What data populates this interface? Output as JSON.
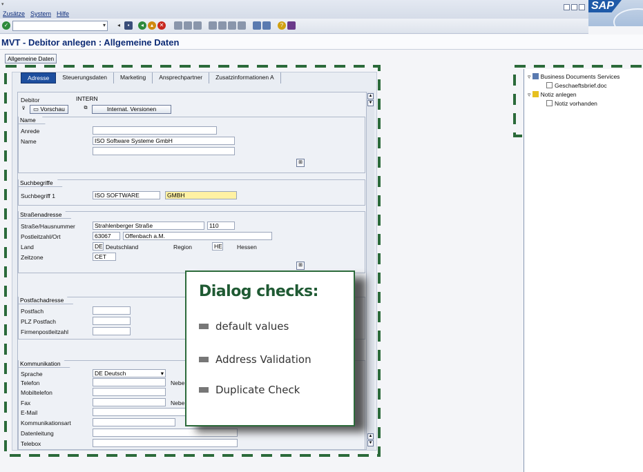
{
  "menu": {
    "items": [
      "Zusätze",
      "System",
      "Hilfe"
    ]
  },
  "brand": {
    "logo": "SAP"
  },
  "screen": {
    "title": "MVT - Debitor anlegen : Allgemeine Daten",
    "button_allgemeine": "Allgemeine Daten"
  },
  "tabs": [
    "Adresse",
    "Steuerungsdaten",
    "Marketing",
    "Ansprechpartner",
    "Zusatzinformationen A"
  ],
  "debitor": {
    "label": "Debitor",
    "value": "INTERN",
    "vorschau": "Vorschau",
    "internat": "Internat. Versionen"
  },
  "name_group": {
    "title": "Name",
    "anrede_label": "Anrede",
    "anrede_value": "",
    "name_label": "Name",
    "name_value": "ISO Software Systeme GmbH",
    "name2_value": ""
  },
  "such_group": {
    "title": "Suchbegriffe",
    "label": "Suchbegriff 1",
    "value1": "ISO SOFTWARE",
    "value2": "GMBH"
  },
  "strasse_group": {
    "title": "Straßenadresse",
    "strasse_label": "Straße/Hausnummer",
    "strasse_value": "Strahlenberger Straße",
    "hausnr_value": "110",
    "plz_label": "Postleitzahl/Ort",
    "plz_value": "63067",
    "ort_value": "Offenbach a.M.",
    "land_label": "Land",
    "land_code": "DE",
    "land_name": "Deutschland",
    "region_label": "Region",
    "region_code": "HE",
    "region_name": "Hessen",
    "zeitzone_label": "Zeitzone",
    "zeitzone_value": "CET"
  },
  "postfach_group": {
    "title": "Postfachadresse",
    "postfach_label": "Postfach",
    "plz_postfach_label": "PLZ Postfach",
    "firmen_label": "Firmenpostleitzahl"
  },
  "komm_group": {
    "title": "Kommunikation",
    "sprache_label": "Sprache",
    "sprache_value": "DE Deutsch",
    "telefon_label": "Telefon",
    "neben1": "Nebe",
    "mobil_label": "Mobiltelefon",
    "fax_label": "Fax",
    "neben2": "Nebe",
    "email_label": "E-Mail",
    "kommart_label": "Kommunikationsart",
    "datenl_label": "Datenleitung",
    "telebox_label": "Telebox"
  },
  "tree": {
    "node1": "Business Documents Services",
    "leaf1": "Geschaeftsbrief.doc",
    "node2": "Notiz anlegen",
    "leaf2": "Notiz vorhanden"
  },
  "callout": {
    "title": "Dialog checks:",
    "items": [
      "default values",
      "Address Validation",
      "Duplicate Check"
    ]
  },
  "colors": {
    "accent_green": "#2b6a3a",
    "tab_blue": "#1d4e9e",
    "highlight_yellow": "#fff1a3"
  }
}
